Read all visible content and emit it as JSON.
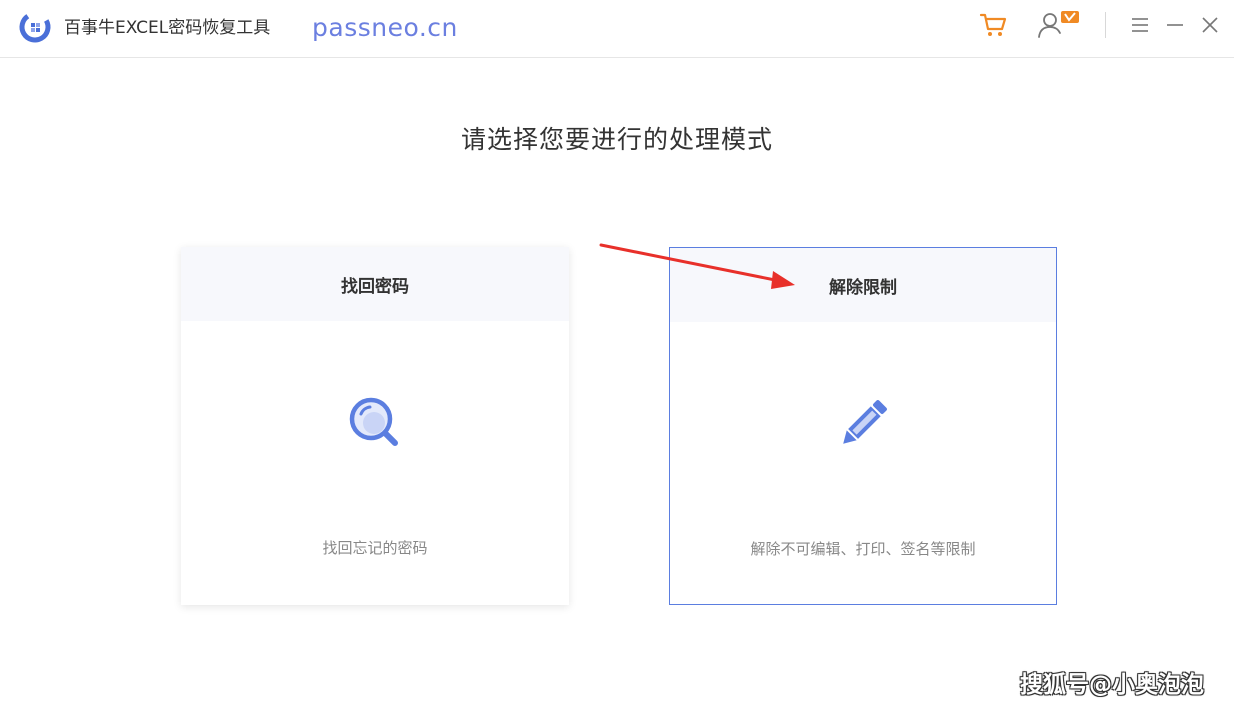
{
  "window": {
    "app_title": "百事牛EXCEL密码恢复工具",
    "watermark_url": "passneo.cn",
    "icons": {
      "logo": "app-logo-icon",
      "cart": "shopping-cart-icon",
      "user": "user-vip-icon",
      "menu": "hamburger-menu-icon",
      "minimize": "minimize-icon",
      "close": "close-icon"
    }
  },
  "main": {
    "heading": "请选择您要进行的处理模式",
    "cards": [
      {
        "title": "找回密码",
        "description": "找回忘记的密码",
        "icon": "magnifier-icon",
        "selected": false
      },
      {
        "title": "解除限制",
        "description": "解除不可编辑、打印、签名等限制",
        "icon": "pencil-icon",
        "selected": true
      }
    ]
  },
  "footer": {
    "watermark": "搜狐号@小奥泡泡"
  },
  "colors": {
    "accent": "#5b7ee0",
    "cart": "#f08a24",
    "annotation": "#e8302a",
    "card_header_bg": "#f7f8fc"
  }
}
